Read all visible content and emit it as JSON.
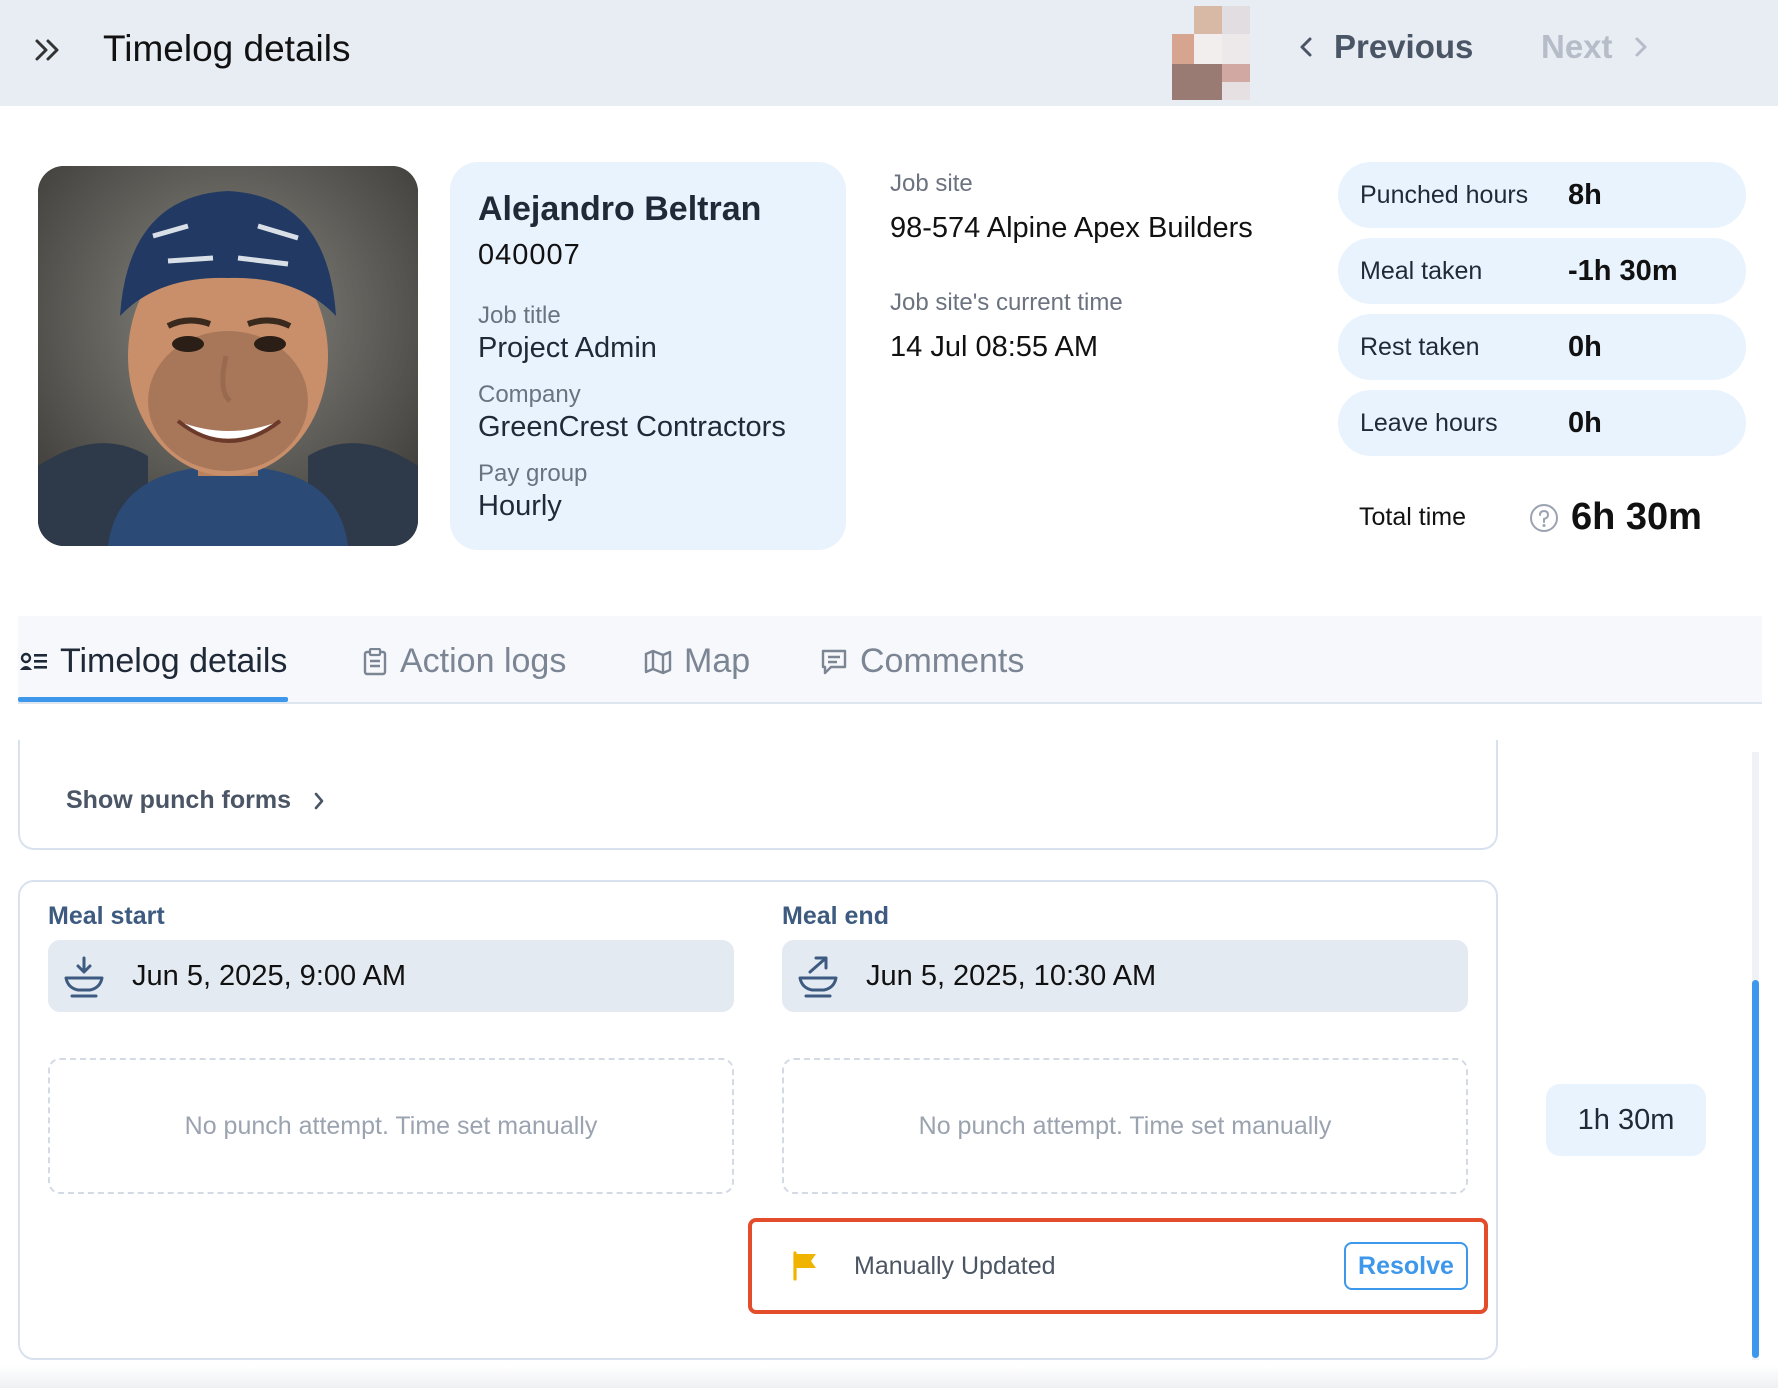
{
  "header": {
    "title": "Timelog details",
    "previous_label": "Previous",
    "next_label": "Next"
  },
  "employee": {
    "name": "Alejandro Beltran",
    "id": "040007",
    "job_title_label": "Job title",
    "job_title": "Project Admin",
    "company_label": "Company",
    "company": "GreenCrest Contractors",
    "pay_group_label": "Pay group",
    "pay_group": "Hourly"
  },
  "job_site": {
    "label": "Job site",
    "value": "98-574 Alpine Apex Builders",
    "time_label": "Job site's current time",
    "time_value": "14 Jul 08:55 AM"
  },
  "stats": [
    {
      "label": "Punched hours",
      "value": "8h"
    },
    {
      "label": "Meal taken",
      "value": "-1h 30m"
    },
    {
      "label": "Rest taken",
      "value": "0h"
    },
    {
      "label": "Leave hours",
      "value": "0h"
    }
  ],
  "total": {
    "label": "Total time",
    "value": "6h 30m"
  },
  "tabs": [
    {
      "label": "Timelog details",
      "icon": "timelog-details-icon",
      "active": true
    },
    {
      "label": "Action logs",
      "icon": "clipboard-icon",
      "active": false
    },
    {
      "label": "Map",
      "icon": "map-icon",
      "active": false
    },
    {
      "label": "Comments",
      "icon": "comment-icon",
      "active": false
    }
  ],
  "punch_forms": {
    "label": "Show punch forms"
  },
  "meal": {
    "start_label": "Meal start",
    "start_value": "Jun 5, 2025, 9:00 AM",
    "end_label": "Meal end",
    "end_value": "Jun 5, 2025, 10:30 AM",
    "start_attempt": "No punch attempt. Time set manually",
    "end_attempt": "No punch attempt. Time set manually",
    "duration": "1h 30m"
  },
  "flag": {
    "text": "Manually Updated",
    "resolve_label": "Resolve",
    "color": "#f0b400"
  },
  "colors": {
    "accent": "#3d97ea",
    "highlight_border": "#e34d2c",
    "card_bg": "#e8f3fd"
  }
}
